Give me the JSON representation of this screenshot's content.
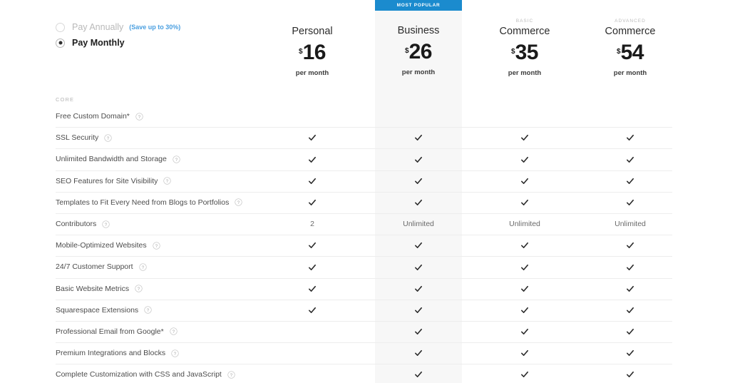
{
  "billing": {
    "options": [
      {
        "label": "Pay Annually",
        "selected": false,
        "note": "(Save up to 30%)"
      },
      {
        "label": "Pay Monthly",
        "selected": true,
        "note": ""
      }
    ]
  },
  "badge": {
    "label": "MOST POPULAR"
  },
  "colors": {
    "accent_blue": "#1b8bce",
    "save_note_blue": "#4a9fe0",
    "highlight_band": "#f7f7f7",
    "rule": "#ededed"
  },
  "plans": [
    {
      "eyebrow": "",
      "name": "Personal",
      "currency": "$",
      "amount": "16",
      "period": "per month",
      "popular": false
    },
    {
      "eyebrow": "",
      "name": "Business",
      "currency": "$",
      "amount": "26",
      "period": "per month",
      "popular": true
    },
    {
      "eyebrow": "BASIC",
      "name": "Commerce",
      "currency": "$",
      "amount": "35",
      "period": "per month",
      "popular": false
    },
    {
      "eyebrow": "ADVANCED",
      "name": "Commerce",
      "currency": "$",
      "amount": "54",
      "period": "per month",
      "popular": false
    }
  ],
  "sections": [
    {
      "title": "CORE"
    }
  ],
  "features": [
    {
      "label": "Free Custom Domain*",
      "help": "help-icon",
      "values": [
        "",
        "",
        "",
        ""
      ]
    },
    {
      "label": "SSL Security",
      "help": "help-icon",
      "values": [
        "check",
        "check",
        "check",
        "check"
      ]
    },
    {
      "label": "Unlimited Bandwidth and Storage",
      "help": "help-icon",
      "values": [
        "check",
        "check",
        "check",
        "check"
      ]
    },
    {
      "label": "SEO Features for Site Visibility",
      "help": "help-icon",
      "values": [
        "check",
        "check",
        "check",
        "check"
      ]
    },
    {
      "label": "Templates to Fit Every Need from Blogs to Portfolios",
      "help": "help-icon",
      "values": [
        "check",
        "check",
        "check",
        "check"
      ]
    },
    {
      "label": "Contributors",
      "help": "help-icon",
      "values": [
        "2",
        "Unlimited",
        "Unlimited",
        "Unlimited"
      ]
    },
    {
      "label": "Mobile-Optimized Websites",
      "help": "help-icon",
      "values": [
        "check",
        "check",
        "check",
        "check"
      ]
    },
    {
      "label": "24/7 Customer Support",
      "help": "help-icon",
      "values": [
        "check",
        "check",
        "check",
        "check"
      ]
    },
    {
      "label": "Basic Website Metrics",
      "help": "help-icon",
      "values": [
        "check",
        "check",
        "check",
        "check"
      ]
    },
    {
      "label": "Squarespace Extensions",
      "help": "help-icon",
      "values": [
        "check",
        "check",
        "check",
        "check"
      ]
    },
    {
      "label": "Professional Email from Google*",
      "help": "help-icon",
      "values": [
        "",
        "check",
        "check",
        "check"
      ]
    },
    {
      "label": "Premium Integrations and Blocks",
      "help": "help-icon",
      "values": [
        "",
        "check",
        "check",
        "check"
      ]
    },
    {
      "label": "Complete Customization with CSS and JavaScript",
      "help": "help-icon",
      "values": [
        "",
        "check",
        "check",
        "check"
      ]
    }
  ]
}
